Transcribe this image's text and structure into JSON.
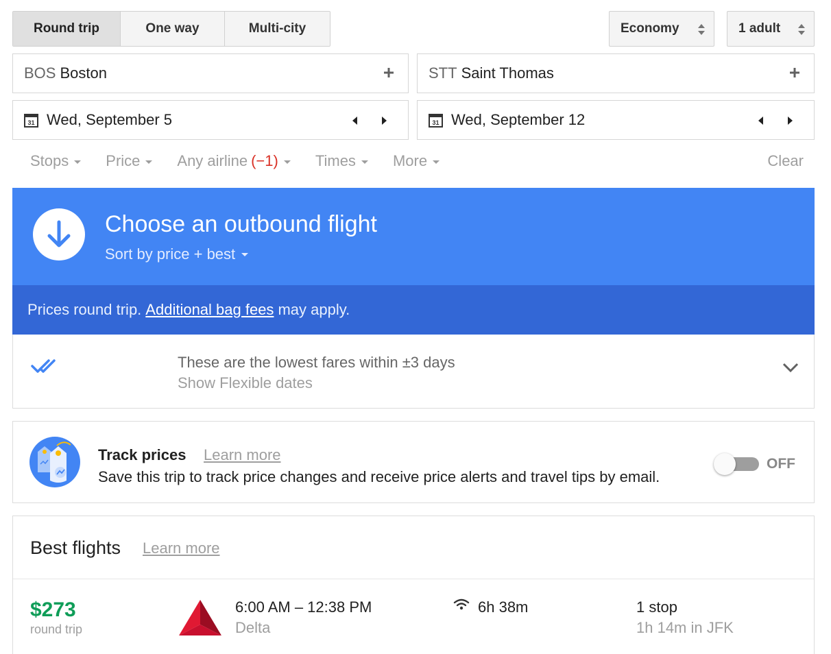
{
  "trip_type": {
    "options": [
      "Round trip",
      "One way",
      "Multi-city"
    ],
    "selected": "Round trip"
  },
  "cabin": {
    "label": "Economy"
  },
  "passengers": {
    "label": "1 adult"
  },
  "origin": {
    "code": "BOS",
    "city": "Boston"
  },
  "destination": {
    "code": "STT",
    "city": "Saint Thomas"
  },
  "depart_date": {
    "value": "Wed, September 5",
    "cal_day": "31"
  },
  "return_date": {
    "value": "Wed, September 12",
    "cal_day": "31"
  },
  "filters": {
    "stops": "Stops",
    "price": "Price",
    "airline": "Any airline",
    "airline_excluded": "(−1)",
    "times": "Times",
    "more": "More",
    "clear": "Clear"
  },
  "header": {
    "title": "Choose an outbound flight",
    "sort": "Sort by price + best"
  },
  "notice": {
    "before": "Prices round trip.",
    "link": "Additional bag fees",
    "after": "may apply."
  },
  "lowest_fares": {
    "text": "These are the lowest fares within ±3 days",
    "link": "Show Flexible dates"
  },
  "track_prices": {
    "title": "Track prices",
    "learn_more": "Learn more",
    "description": "Save this trip to track price changes and receive price alerts and travel tips by email.",
    "toggle_state": "OFF"
  },
  "best_flights": {
    "title": "Best flights",
    "learn_more": "Learn more",
    "flights": [
      {
        "price": "$273",
        "price_note": "round trip",
        "times": "6:00 AM – 12:38 PM",
        "airline": "Delta",
        "duration": "6h 38m",
        "stops": "1 stop",
        "layover": "1h 14m in JFK"
      }
    ]
  },
  "colors": {
    "header_blue": "#4285f4",
    "notice_blue": "#3367d6",
    "price_green": "#0f9d58",
    "excluded_red": "#d93025",
    "delta_red": "#c8102e"
  }
}
